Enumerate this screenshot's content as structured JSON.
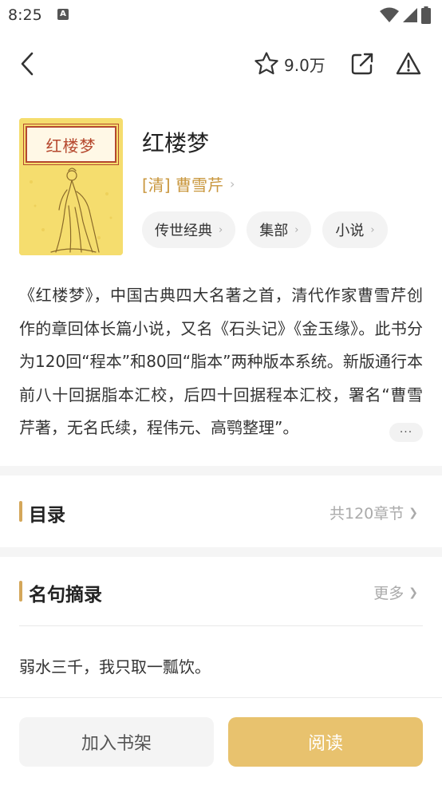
{
  "status_bar": {
    "time": "8:25",
    "notification_letter": "A",
    "icons": [
      "wifi-icon",
      "signal-icon",
      "battery-icon"
    ]
  },
  "nav": {
    "back_icon": "chevron-left-icon",
    "favorite_count": "9.0万",
    "favorite_icon": "star-outline-icon",
    "share_icon": "share-icon",
    "report_icon": "warning-icon"
  },
  "book": {
    "cover_title": "红楼梦",
    "title": "红楼梦",
    "author": "[清] 曹雪芹",
    "tags": [
      {
        "label": "传世经典"
      },
      {
        "label": "集部"
      },
      {
        "label": "小说"
      }
    ],
    "description": "《红楼梦》，中国古典四大名著之首，清代作家曹雪芹创作的章回体长篇小说，又名《石头记》《金玉缘》。此书分为120回“程本”和80回“脂本”两种版本系统。新版通行本前八十回据脂本汇校，后四十回据程本汇校，署名“曹雪芹著，无名氏续，程伟元、高鹗整理”。",
    "more_label": "···"
  },
  "catalog": {
    "title": "目录",
    "summary": "共120章节"
  },
  "quotes": {
    "title": "名句摘录",
    "more_label": "更多",
    "items": [
      "弱水三千，我只取一瓢饮。"
    ]
  },
  "actions": {
    "add_shelf_label": "加入书架",
    "read_label": "阅读"
  },
  "colors": {
    "accent": "#d4a75a",
    "author": "#c9973e",
    "read_button": "#e8c26e",
    "cover_bg": "#f5dd6e",
    "cover_frame": "#b5482e"
  }
}
